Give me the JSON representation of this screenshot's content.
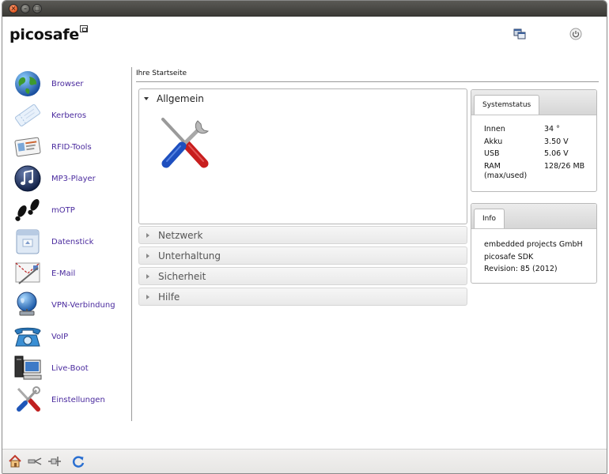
{
  "window": {
    "close_glyph": "×",
    "min_glyph": "–",
    "max_glyph": "□"
  },
  "header": {
    "app_name": "picosafe"
  },
  "sidebar": {
    "items": [
      {
        "label": "Browser",
        "icon": "globe-icon"
      },
      {
        "label": "Kerberos",
        "icon": "ticket-icon"
      },
      {
        "label": "RFID-Tools",
        "icon": "rfid-card-icon"
      },
      {
        "label": "MP3-Player",
        "icon": "music-note-icon"
      },
      {
        "label": "mOTP",
        "icon": "footprints-icon"
      },
      {
        "label": "Datenstick",
        "icon": "usb-drive-icon"
      },
      {
        "label": "E-Mail",
        "icon": "envelope-icon"
      },
      {
        "label": "VPN-Verbindung",
        "icon": "vpn-globe-icon"
      },
      {
        "label": "VoIP",
        "icon": "telephone-icon"
      },
      {
        "label": "Live-Boot",
        "icon": "computer-icon"
      },
      {
        "label": "Einstellungen",
        "icon": "tools-icon"
      }
    ]
  },
  "main": {
    "section_title": "Ihre Startseite",
    "open_section": "Allgemein",
    "closed_sections": [
      "Netzwerk",
      "Unterhaltung",
      "Sicherheit",
      "Hilfe"
    ]
  },
  "systemstatus": {
    "tab": "Systemstatus",
    "rows": [
      {
        "key": "Innen",
        "value": "34 °"
      },
      {
        "key": "Akku",
        "value": "3.50 V"
      },
      {
        "key": "USB",
        "value": "5.06 V"
      },
      {
        "key": "RAM",
        "value": "128/26 MB"
      },
      {
        "key": "(max/used)",
        "value": ""
      }
    ]
  },
  "info": {
    "tab": "Info",
    "lines": [
      "embedded projects GmbH",
      "picosafe SDK",
      "Revision: 85 (2012)"
    ]
  },
  "colors": {
    "link": "#4a2a9e",
    "titlebar": "#3c3b37",
    "close_button": "#e2531d"
  }
}
